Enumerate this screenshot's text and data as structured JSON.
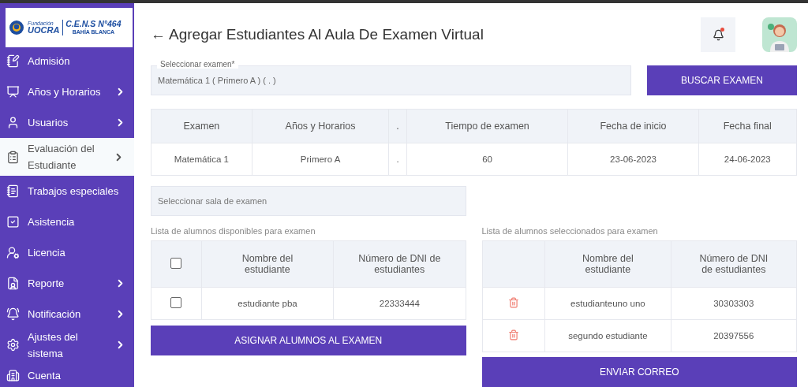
{
  "logo": {
    "foundation": "Fundación",
    "org": "UOCRA",
    "school": "C.E.N.S N°464",
    "city": "BAHÍA BLANCA"
  },
  "sidebar": {
    "items": [
      {
        "label": "Admisión",
        "expandable": false,
        "selected": false
      },
      {
        "label": "Años y Horarios",
        "expandable": true,
        "selected": false
      },
      {
        "label": "Usuarios",
        "expandable": true,
        "selected": false
      },
      {
        "label": "Evaluación del Estudiante",
        "expandable": true,
        "selected": true
      },
      {
        "label": "Trabajos especiales",
        "expandable": false,
        "selected": false
      },
      {
        "label": "Asistencia",
        "expandable": false,
        "selected": false
      },
      {
        "label": "Licencia",
        "expandable": false,
        "selected": false
      },
      {
        "label": "Reporte",
        "expandable": true,
        "selected": false
      },
      {
        "label": "Notificación",
        "expandable": true,
        "selected": false
      },
      {
        "label": "Ajustes del sistema",
        "expandable": true,
        "selected": false
      },
      {
        "label": "Cuenta",
        "expandable": false,
        "selected": false
      }
    ]
  },
  "header": {
    "back": "←",
    "title": "Agregar Estudiantes Al Aula De Examen Virtual",
    "notification_dot": true
  },
  "exam_field": {
    "label": "Seleccionar examen*",
    "value": "Matemática 1 ( Primero A ) ( . )"
  },
  "search_button": "BUSCAR EXAMEN",
  "exam_table": {
    "columns": [
      "Examen",
      "Años y Horarios",
      ".",
      "Tiempo de examen",
      "Fecha de inicio",
      "Fecha final"
    ],
    "rows": [
      [
        "Matemática 1",
        "Primero A",
        ".",
        "60",
        "23-06-2023",
        "24-06-2023"
      ]
    ]
  },
  "room_field": {
    "placeholder": "Seleccionar sala de examen"
  },
  "available": {
    "title": "Lista de alumnos disponibles para examen",
    "columns": [
      "Nombre del estudiante",
      "Número de DNI de estudiantes"
    ],
    "all_checked": false,
    "rows": [
      {
        "name": "estudiante pba",
        "dni": "22333444",
        "checked": false
      }
    ],
    "button": "ASIGNAR ALUMNOS AL EXAMEN"
  },
  "selected_list": {
    "title": "Lista de alumnos seleccionados para examen",
    "columns": [
      "Nombre del estudiante",
      "Número de DNI de estudiantes"
    ],
    "rows": [
      {
        "name": "estudianteuno uno",
        "dni": "30303303"
      },
      {
        "name": "segundo estudiante",
        "dni": "20397556"
      }
    ],
    "button": "ENVIAR CORREO"
  }
}
